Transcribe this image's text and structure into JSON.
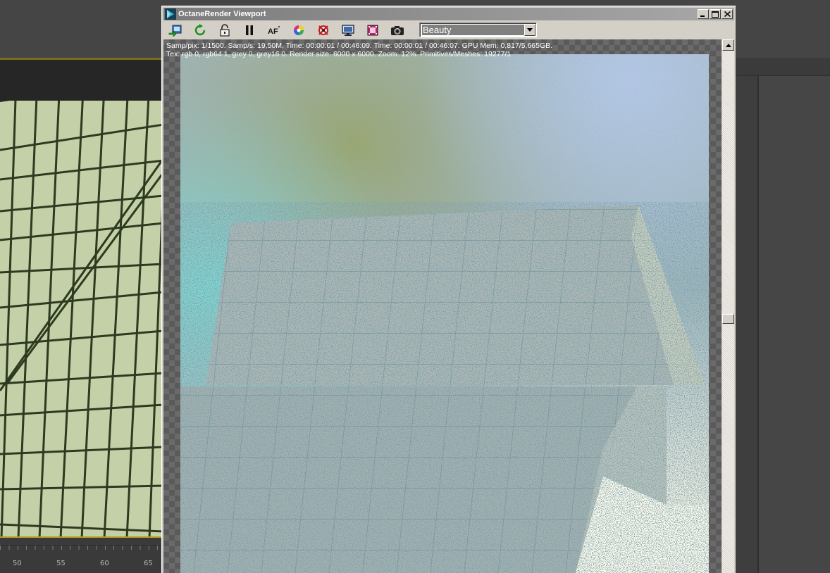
{
  "window": {
    "title": "OctaneRender Viewport",
    "controls": [
      "minimize",
      "maximize",
      "close"
    ]
  },
  "toolbar": {
    "buttons": [
      {
        "name": "send-scene-button",
        "icon": "send-scene-icon"
      },
      {
        "name": "restart-render-button",
        "icon": "refresh-icon"
      },
      {
        "name": "lock-button",
        "icon": "lock-icon"
      },
      {
        "name": "pause-button",
        "icon": "pause-icon"
      },
      {
        "name": "af-button",
        "icon": "af-icon",
        "label": "AF"
      },
      {
        "name": "color-button",
        "icon": "color-wheel-icon"
      },
      {
        "name": "region-button",
        "icon": "crosshair-region-icon"
      },
      {
        "name": "display-button",
        "icon": "monitor-icon"
      },
      {
        "name": "film-button",
        "icon": "film-icon"
      },
      {
        "name": "camera-button",
        "icon": "camera-icon"
      }
    ],
    "render_pass": {
      "selected": "Beauty"
    }
  },
  "stats": {
    "line1": "Samp/pix: 1/1500.   Samp/s: 19,50M.   Time: 00:00:01 / 00:46:09.   Time: 00:00:01 / 00:46:07.   GPU Mem: 0,817/5,665GB.",
    "line2": "Tex: rgb 0, rgb64 1, grey 0, grey16 0.   Render size: 6000 x 6000.   Zoom: 12%.   Primitives/Meshes: 19277/1"
  },
  "timeline": {
    "ticks": [
      "50",
      "55",
      "60",
      "65"
    ]
  },
  "colors": {
    "viewport_plane": "#c3d0a8",
    "grid_lines": "#2d3a1f",
    "accent_yellow": "#b89c22"
  }
}
